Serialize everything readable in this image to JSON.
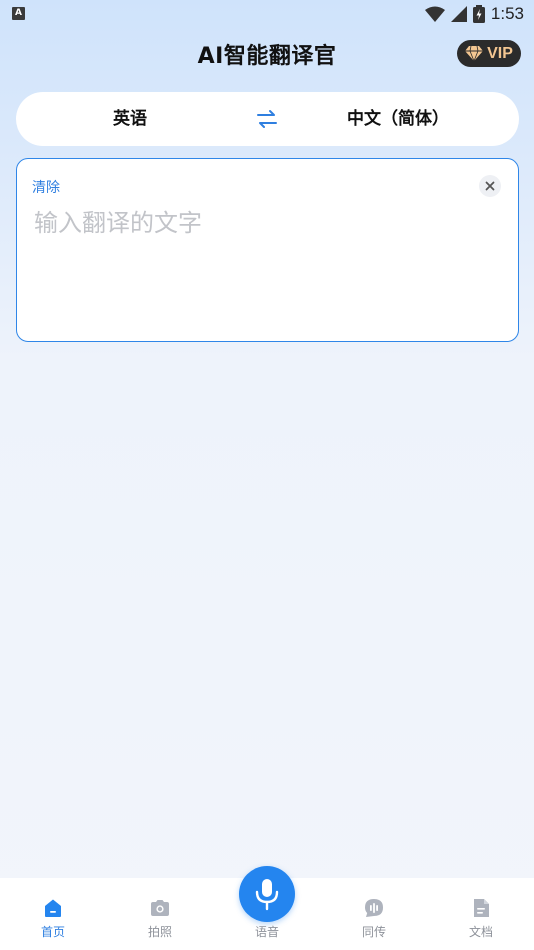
{
  "status_bar": {
    "time": "1:53"
  },
  "header": {
    "title": "AI智能翻译官",
    "vip_label": "VIP"
  },
  "language": {
    "source": "英语",
    "target": "中文（简体）"
  },
  "input": {
    "clear_label": "清除",
    "placeholder": "输入翻译的文字",
    "value": ""
  },
  "nav": {
    "home": "首页",
    "photo": "拍照",
    "voice": "语音",
    "interpret": "同传",
    "document": "文档"
  },
  "colors": {
    "accent": "#2485ef",
    "vip_text": "#f3c691"
  }
}
